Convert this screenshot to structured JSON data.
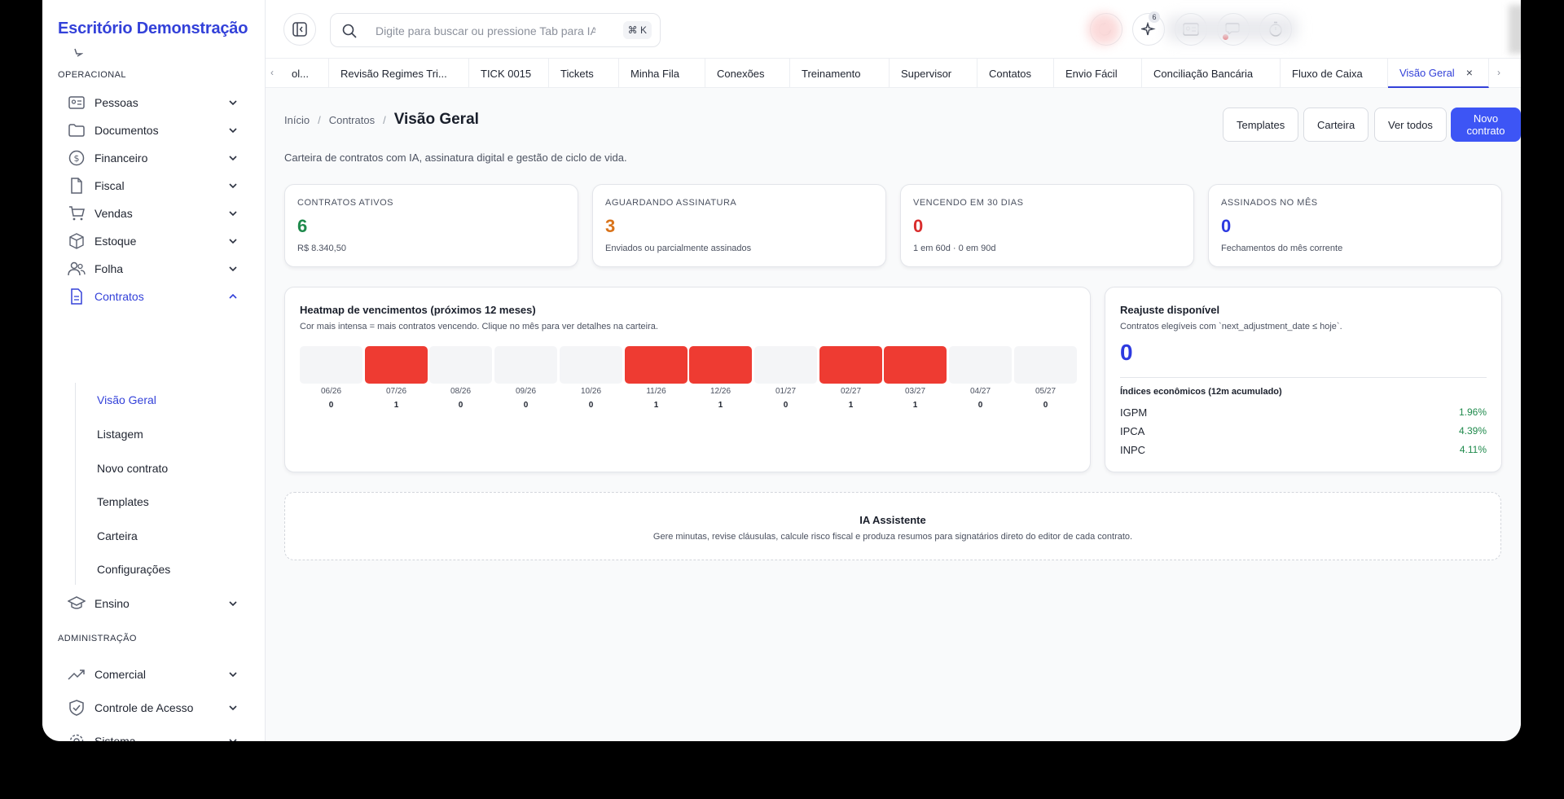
{
  "brand": "Escritório Demonstração",
  "sidebar": {
    "sections": {
      "operacional": "OPERACIONAL",
      "administracao": "ADMINISTRAÇÃO"
    },
    "items": {
      "pessoas": "Pessoas",
      "documentos": "Documentos",
      "financeiro": "Financeiro",
      "fiscal": "Fiscal",
      "vendas": "Vendas",
      "estoque": "Estoque",
      "folha": "Folha",
      "contratos": "Contratos",
      "ensino": "Ensino",
      "comercial": "Comercial",
      "controle": "Controle de Acesso",
      "sistema": "Sistema"
    },
    "contratos_sub": {
      "visao": "Visão Geral",
      "listagem": "Listagem",
      "novo": "Novo contrato",
      "templates": "Templates",
      "carteira": "Carteira",
      "config": "Configurações"
    }
  },
  "header": {
    "search_placeholder": "Digite para buscar ou pressione Tab para IA",
    "shortcut": "⌘ K",
    "ai_badge": "6"
  },
  "tabs": [
    "ol...",
    "Revisão Regimes Tri...",
    "TICK 0015",
    "Tickets",
    "Minha Fila",
    "Conexões",
    "Treinamento",
    "Supervisor",
    "Contatos",
    "Envio Fácil",
    "Conciliação Bancária",
    "Fluxo de Caixa",
    "Visão Geral"
  ],
  "breadcrumb": {
    "home": "Início",
    "section": "Contratos",
    "current": "Visão Geral"
  },
  "subtitle": "Carteira de contratos com IA, assinatura digital e gestão de ciclo de vida.",
  "actions": {
    "templates": "Templates",
    "carteira": "Carteira",
    "ver_todos": "Ver todos",
    "novo": "Novo contrato"
  },
  "kpis": [
    {
      "label": "CONTRATOS ATIVOS",
      "value": "6",
      "sub": "R$ 8.340,50",
      "color": "#1f8a4c"
    },
    {
      "label": "AGUARDANDO ASSINATURA",
      "value": "3",
      "sub": "Enviados ou parcialmente assinados",
      "color": "#d9731a"
    },
    {
      "label": "VENCENDO EM 30 DIAS",
      "value": "0",
      "sub": "1 em 60d · 0 em 90d",
      "color": "#d92d2d"
    },
    {
      "label": "ASSINADOS NO MÊS",
      "value": "0",
      "sub": "Fechamentos do mês corrente",
      "color": "#2d3ae0"
    }
  ],
  "heatmap": {
    "title": "Heatmap de vencimentos (próximos 12 meses)",
    "subtitle": "Cor mais intensa = mais contratos vencendo. Clique no mês para ver detalhes na carteira.",
    "months": [
      "06/26",
      "07/26",
      "08/26",
      "09/26",
      "10/26",
      "11/26",
      "12/26",
      "01/27",
      "02/27",
      "03/27",
      "04/27",
      "05/27"
    ],
    "counts": [
      0,
      1,
      0,
      0,
      0,
      1,
      1,
      0,
      1,
      1,
      0,
      0
    ],
    "active_color": "#ee3b32",
    "empty_color": "#f4f5f7"
  },
  "reajuste": {
    "title": "Reajuste disponível",
    "subtitle": "Contratos elegíveis com `next_adjustment_date ≤ hoje`.",
    "value": "0",
    "indices_title": "Índices econômicos (12m acumulado)",
    "indices": [
      {
        "name": "IGPM",
        "value": "1.96%"
      },
      {
        "name": "IPCA",
        "value": "4.39%"
      },
      {
        "name": "INPC",
        "value": "4.11%"
      }
    ]
  },
  "ai": {
    "title": "IA Assistente",
    "subtitle": "Gere minutas, revise cláusulas, calcule risco fiscal e produza resumos para signatários direto do editor de cada contrato."
  }
}
